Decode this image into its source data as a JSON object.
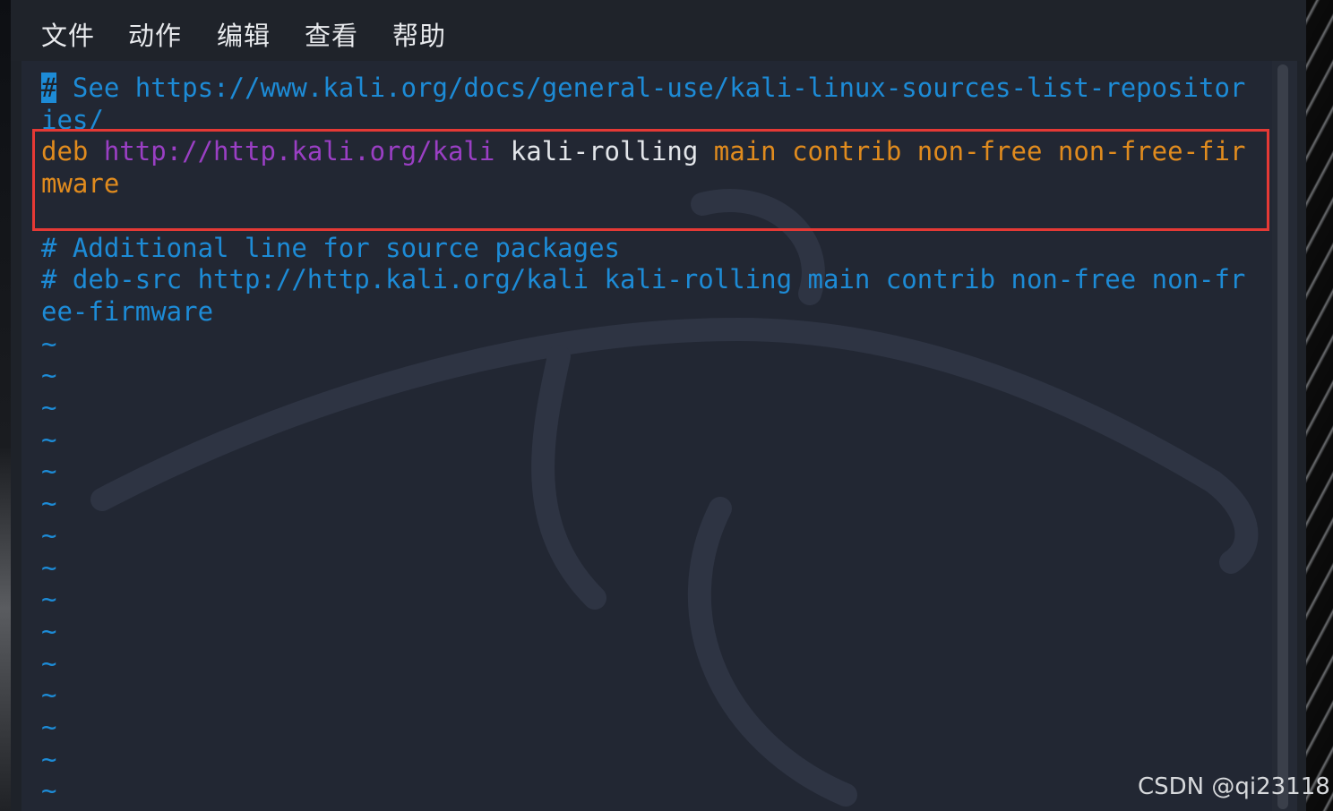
{
  "menubar": {
    "items": [
      "文件",
      "动作",
      "编辑",
      "查看",
      "帮助"
    ]
  },
  "editor": {
    "lines": [
      {
        "segments": [
          {
            "text": "#",
            "style": "cursor"
          },
          {
            "text": " See https://www.kali.org/docs/general-use/kali-linux-sources-list-repositor",
            "style": "comment"
          }
        ]
      },
      {
        "segments": [
          {
            "text": "ies/",
            "style": "comment"
          }
        ]
      },
      {
        "segments": [
          {
            "text": "deb ",
            "style": "orange"
          },
          {
            "text": "http://http.kali.org/kali",
            "style": "purple"
          },
          {
            "text": " kali-rolling ",
            "style": "white"
          },
          {
            "text": "main contrib non-free non-free-fir",
            "style": "orange"
          }
        ]
      },
      {
        "segments": [
          {
            "text": "mware",
            "style": "orange"
          }
        ]
      },
      {
        "segments": []
      },
      {
        "segments": [
          {
            "text": "# Additional line for source packages",
            "style": "comment"
          }
        ]
      },
      {
        "segments": [
          {
            "text": "# deb-src http://http.kali.org/kali kali-rolling main contrib non-free non-fr",
            "style": "comment"
          }
        ]
      },
      {
        "segments": [
          {
            "text": "ee-firmware",
            "style": "comment"
          }
        ]
      }
    ],
    "empty_line_marker": "~",
    "empty_line_count": 15
  },
  "colors": {
    "comment": "#1d8bd6",
    "keyword": "#e08b1e",
    "url": "#9a3fc4",
    "text": "#e3e6ea",
    "highlight_box": "#e53935",
    "terminal_bg": "#222733"
  },
  "watermark_text": "CSDN @qi23118"
}
